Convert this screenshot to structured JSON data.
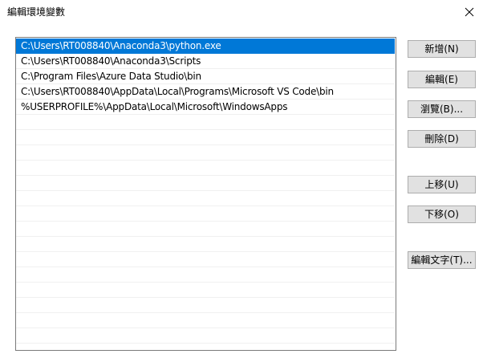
{
  "window": {
    "title": "編輯環境變數"
  },
  "paths": [
    "C:\\Users\\RT008840\\Anaconda3\\python.exe",
    "C:\\Users\\RT008840\\Anaconda3\\Scripts",
    "C:\\Program Files\\Azure Data Studio\\bin",
    "C:\\Users\\RT008840\\AppData\\Local\\Programs\\Microsoft VS Code\\bin",
    "%USERPROFILE%\\AppData\\Local\\Microsoft\\WindowsApps"
  ],
  "selected_index": 0,
  "buttons": {
    "new": "新增(N)",
    "edit": "編輯(E)",
    "browse": "瀏覽(B)...",
    "delete": "刪除(D)",
    "move_up": "上移(U)",
    "move_down": "下移(O)",
    "edit_text": "編輯文字(T)..."
  },
  "colors": {
    "selection": "#0078d7",
    "button_face": "#e1e1e1"
  }
}
